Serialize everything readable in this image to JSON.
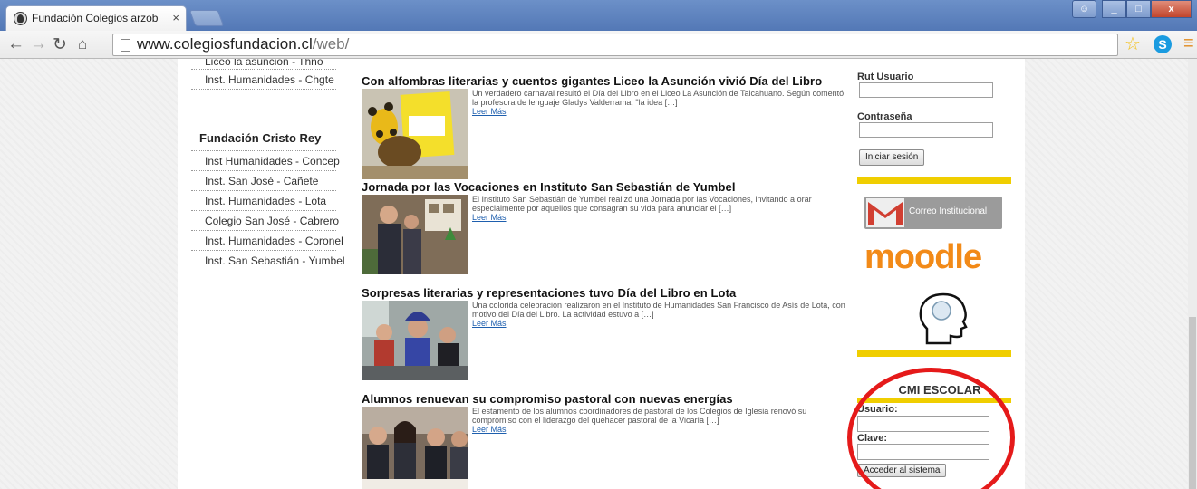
{
  "browser": {
    "tab_title": "Fundación Colegios arzob",
    "tab_close": "×",
    "url_host": "www.colegiosfundacion.cl",
    "url_path": "/web/",
    "window_buttons": [
      "_",
      "□",
      "x"
    ]
  },
  "sidebar": {
    "group1_items": [
      "Liceo la asuncion - Thno",
      "Inst. Humanidades - Chgte"
    ],
    "group2_title": "Fundación Cristo Rey",
    "group2_items": [
      "Inst Humanidades - Concep",
      "Inst. San José - Cañete",
      "Inst. Humanidades - Lota",
      "Colegio San José - Cabrero",
      "Inst. Humanidades - Coronel",
      "Inst. San Sebastián - Yumbel"
    ]
  },
  "articles": [
    {
      "title": "Con alfombras literarias y cuentos gigantes Liceo la Asunción vivió Día del Libro",
      "excerpt": "Un verdadero carnaval resultó el Día del Libro en el Liceo La Asunción de Talcahuano. Según comentó la profesora de lenguaje Gladys Valderrama, \"la idea […]",
      "link": "Leer Más"
    },
    {
      "title": "Jornada por las Vocaciones en Instituto San Sebastián de Yumbel",
      "excerpt": "El Instituto San Sebastián de Yumbel realizó una Jornada por las Vocaciones, invitando a orar especialmente por aquellos que consagran su vida para anunciar el […]",
      "link": "Leer Más"
    },
    {
      "title": "Sorpresas literarias y representaciones tuvo Día del Libro en Lota",
      "excerpt": "Una colorida celebración realizaron en el Instituto de Humanidades San Francisco de Asís de Lota, con motivo del Día del Libro. La actividad estuvo a […]",
      "link": "Leer Más"
    },
    {
      "title": "Alumnos renuevan su compromiso pastoral con nuevas energías",
      "excerpt": "El estamento de los alumnos coordinadores de pastoral de los Colegios de Iglesia renovó su compromiso con el liderazgo del quehacer pastoral de la Vicaría […]",
      "link": "Leer Más"
    }
  ],
  "login": {
    "rut_label": "Rut Usuario",
    "password_label": "Contraseña",
    "submit": "Iniciar sesión"
  },
  "links": {
    "mail_banner": "Correo Institucional",
    "moodle": "moodle"
  },
  "cmi": {
    "title": "CMI ESCOLAR",
    "user_label": "Usuario:",
    "key_label": "Clave:",
    "submit": "Acceder al sistema"
  },
  "colors": {
    "accent_yellow": "#f0ce00",
    "link_blue": "#1e5fae",
    "moodle_orange": "#f28a18",
    "highlight_red": "#e51a1a"
  }
}
